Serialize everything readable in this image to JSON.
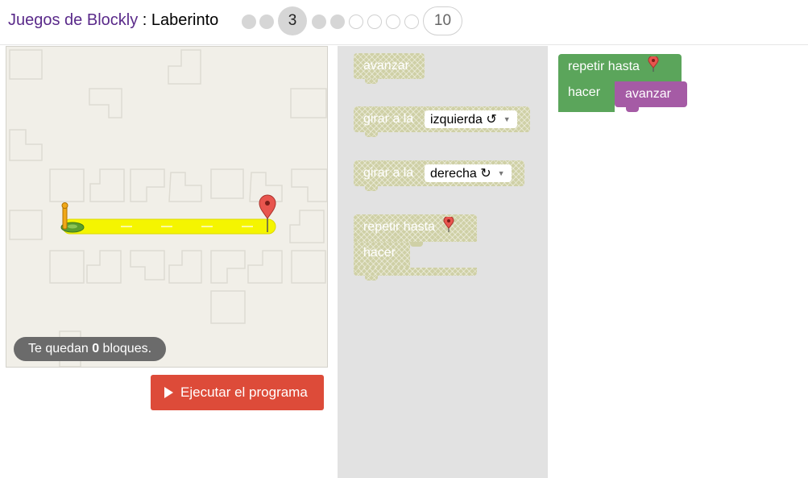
{
  "header": {
    "app_link": "Juegos de Blockly",
    "separator": " : ",
    "title": "Laberinto",
    "current_level": "3",
    "last_level": "10"
  },
  "maze": {
    "capacity_prefix": "Te quedan ",
    "capacity_count": "0",
    "capacity_suffix": " bloques.",
    "path_color": "#f5f500",
    "marker_color": "#e8554e"
  },
  "run_button": {
    "label": "Ejecutar el programa",
    "color": "#dd4b39"
  },
  "toolbox": {
    "move_label": "avanzar",
    "turn_left_prefix": "girar a la",
    "turn_left_value": "izquierda ↺",
    "turn_right_prefix": "girar a la",
    "turn_right_value": "derecha ↻",
    "repeat_label": "repetir hasta",
    "do_label": "hacer"
  },
  "workspace": {
    "repeat_label": "repetir hasta",
    "do_label": "hacer",
    "inner_block_label": "avanzar",
    "loop_color": "#5ba55b",
    "move_color": "#a55ba5"
  }
}
